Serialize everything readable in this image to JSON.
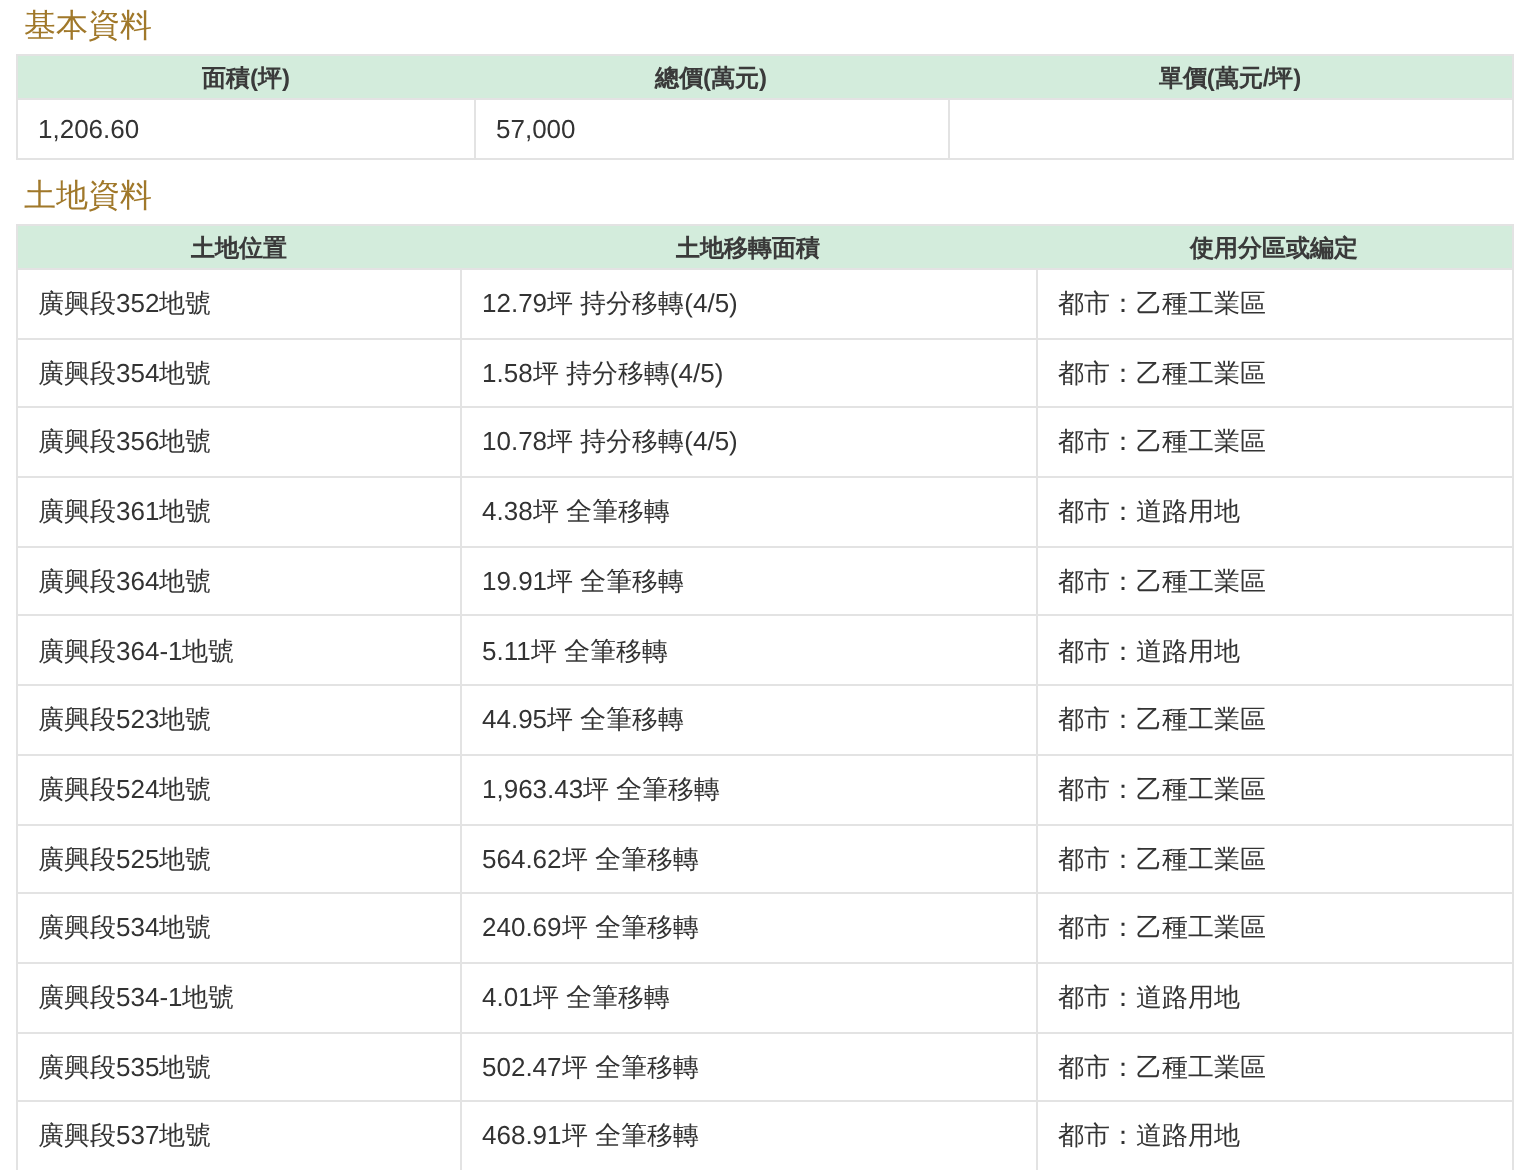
{
  "sections": [
    {
      "title": "基本資料",
      "columns": [
        "面積(坪)",
        "總價(萬元)",
        "單價(萬元/坪)"
      ],
      "kind": "basic",
      "rows": [
        [
          "1,206.60",
          "57,000",
          ""
        ]
      ]
    },
    {
      "title": "土地資料",
      "columns": [
        "土地位置",
        "土地移轉面積",
        "使用分區或編定"
      ],
      "kind": "land",
      "rows": [
        [
          "廣興段352地號",
          "12.79坪 持分移轉(4/5)",
          "都市：乙種工業區"
        ],
        [
          "廣興段354地號",
          "1.58坪 持分移轉(4/5)",
          "都市：乙種工業區"
        ],
        [
          "廣興段356地號",
          "10.78坪 持分移轉(4/5)",
          "都市：乙種工業區"
        ],
        [
          "廣興段361地號",
          "4.38坪 全筆移轉",
          "都市：道路用地"
        ],
        [
          "廣興段364地號",
          "19.91坪 全筆移轉",
          "都市：乙種工業區"
        ],
        [
          "廣興段364-1地號",
          "5.11坪 全筆移轉",
          "都市：道路用地"
        ],
        [
          "廣興段523地號",
          "44.95坪 全筆移轉",
          "都市：乙種工業區"
        ],
        [
          "廣興段524地號",
          "1,963.43坪 全筆移轉",
          "都市：乙種工業區"
        ],
        [
          "廣興段525地號",
          "564.62坪 全筆移轉",
          "都市：乙種工業區"
        ],
        [
          "廣興段534地號",
          "240.69坪 全筆移轉",
          "都市：乙種工業區"
        ],
        [
          "廣興段534-1地號",
          "4.01坪 全筆移轉",
          "都市：道路用地"
        ],
        [
          "廣興段535地號",
          "502.47坪 全筆移轉",
          "都市：乙種工業區"
        ],
        [
          "廣興段537地號",
          "468.91坪 全筆移轉",
          "都市：道路用地"
        ]
      ]
    }
  ]
}
